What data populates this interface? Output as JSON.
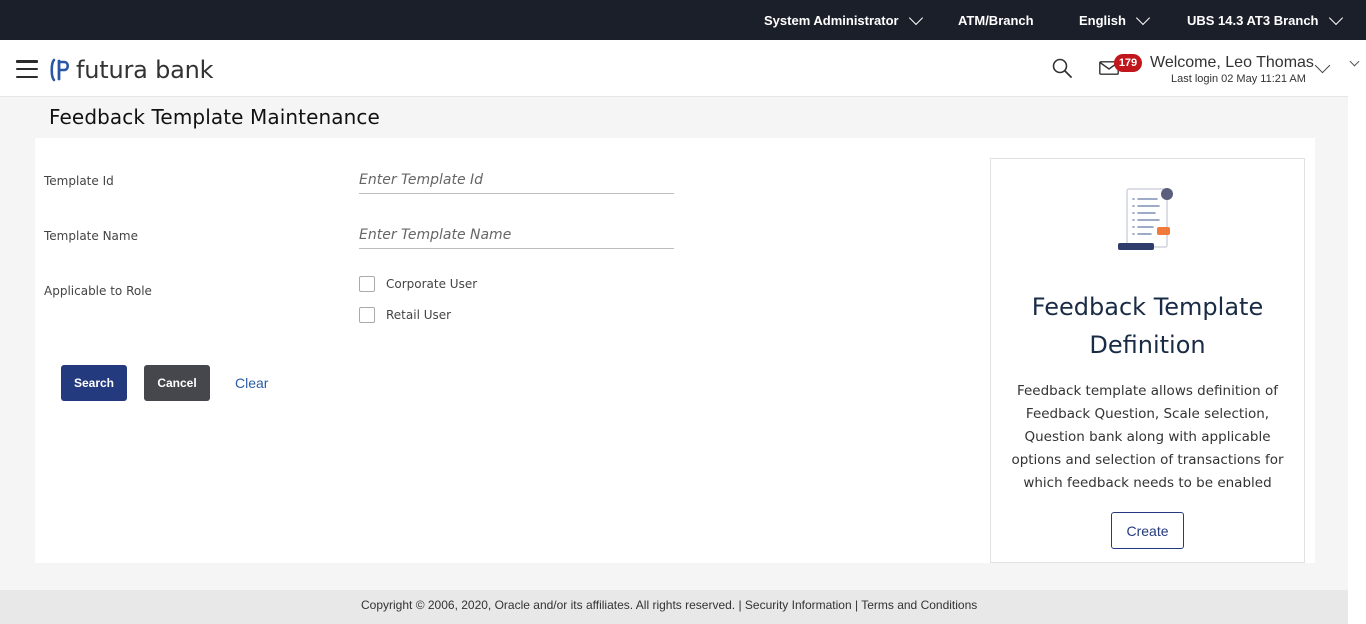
{
  "topbar": {
    "role": "System Administrator",
    "channel": "ATM/Branch",
    "language": "English",
    "branch": "UBS 14.3 AT3 Branch"
  },
  "header": {
    "logo_text": "futura bank",
    "notification_count": "179",
    "welcome": "Welcome, Leo Thomas",
    "last_login": "Last login 02 May 11:21 AM"
  },
  "page": {
    "title": "Feedback Template Maintenance"
  },
  "form": {
    "template_id_label": "Template Id",
    "template_id_placeholder": "Enter Template Id",
    "template_id_value": "",
    "template_name_label": "Template Name",
    "template_name_placeholder": "Enter Template Name",
    "template_name_value": "",
    "role_label": "Applicable to Role",
    "roles": [
      {
        "label": "Corporate User",
        "checked": false
      },
      {
        "label": "Retail User",
        "checked": false
      }
    ]
  },
  "actions": {
    "search": "Search",
    "cancel": "Cancel",
    "clear": "Clear"
  },
  "info": {
    "title": "Feedback Template Definition",
    "description": "Feedback template allows definition of Feedback Question, Scale selection, Question bank along with applicable options and selection of transactions for which feedback needs to be enabled",
    "create": "Create"
  },
  "footer": {
    "copyright": "Copyright © 2006, 2020, Oracle and/or its affiliates. All rights reserved. | Security Information | Terms and Conditions"
  },
  "colors": {
    "topbar_bg": "#1b1f2a",
    "primary": "#243a7e",
    "secondary": "#45474d",
    "badge": "#c0161c",
    "link": "#2b5da8"
  }
}
